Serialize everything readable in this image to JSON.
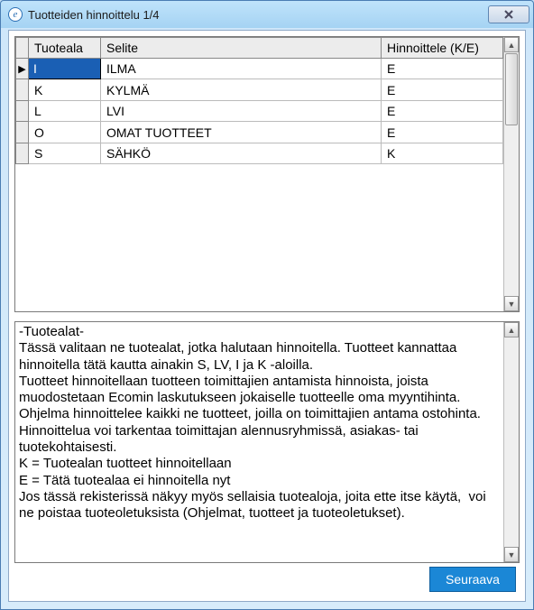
{
  "window": {
    "title": "Tuotteiden hinnoittelu 1/4",
    "app_icon_letter": "e"
  },
  "grid": {
    "columns": {
      "code": "Tuoteala",
      "desc": "Selite",
      "price": "Hinnoittele (K/E)"
    },
    "rows": [
      {
        "code": "I",
        "desc": "ILMA",
        "price": "E",
        "current": true
      },
      {
        "code": "K",
        "desc": "KYLMÄ",
        "price": "E",
        "current": false
      },
      {
        "code": "L",
        "desc": "LVI",
        "price": "E",
        "current": false
      },
      {
        "code": "O",
        "desc": "OMAT TUOTTEET",
        "price": "E",
        "current": false
      },
      {
        "code": "S",
        "desc": "SÄHKÖ",
        "price": "K",
        "current": false
      }
    ]
  },
  "info": {
    "heading": "-Tuotealat-",
    "body": "Tässä valitaan ne tuotealat, jotka halutaan hinnoitella. Tuotteet kannattaa hinnoitella tätä kautta ainakin S, LV, I ja K -aloilla.\nTuotteet hinnoitellaan tuotteen toimittajien antamista hinnoista, joista muodostetaan Ecomin laskutukseen jokaiselle tuotteelle oma myyntihinta.\nOhjelma hinnoittelee kaikki ne tuotteet, joilla on toimittajien antama ostohinta. Hinnoittelua voi tarkentaa toimittajan alennusryhmissä, asiakas- tai tuotekohtaisesti.\nK = Tuotealan tuotteet hinnoitellaan\nE = Tätä tuotealaa ei hinnoitella nyt\nJos tässä rekisterissä näkyy myös sellaisia tuotealoja, joita ette itse käytä,  voi ne poistaa tuoteoletuksista (Ohjelmat, tuotteet ja tuoteoletukset)."
  },
  "buttons": {
    "next": "Seuraava"
  }
}
